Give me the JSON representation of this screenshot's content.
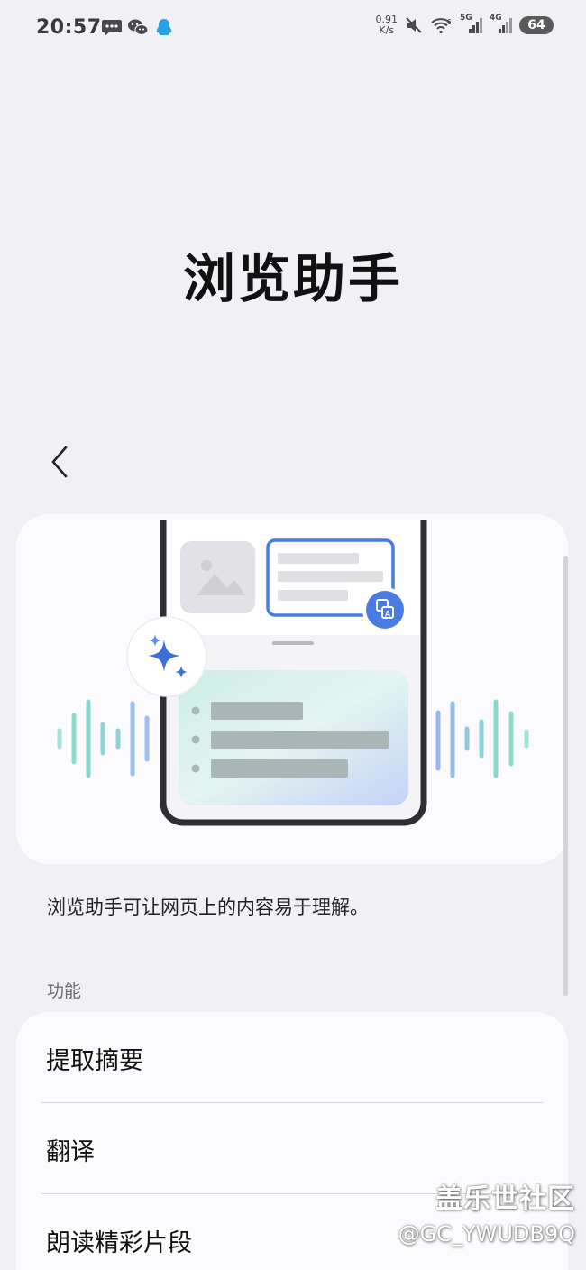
{
  "status_bar": {
    "time": "20:57",
    "notification_icons": [
      "message-icon",
      "wechat-icon",
      "qq-icon"
    ],
    "net_speed_value": "0.91",
    "net_speed_unit": "K/s",
    "signal_labels": [
      "5G",
      "4G"
    ],
    "battery": "64"
  },
  "header": {
    "title": "浏览助手"
  },
  "navigation": {
    "back_icon": "chevron-left-icon"
  },
  "illustration": {
    "icons": [
      "image-icon",
      "translate-icon",
      "sparkle-icon",
      "waveform-icon"
    ],
    "colors": {
      "frame": "#2f2f33",
      "accent_blue": "#4a7be0",
      "wave_teal": "#7ddbc9",
      "wave_blue": "#8fb2ec"
    }
  },
  "description": "浏览助手可让网页上的内容易于理解。",
  "features": {
    "header": "功能",
    "items": [
      {
        "label": "提取摘要"
      },
      {
        "label": "翻译"
      },
      {
        "label": "朗读精彩片段"
      }
    ]
  },
  "watermark": {
    "title": "盖乐世社区",
    "user": "@GC_YWUDB9Q"
  }
}
